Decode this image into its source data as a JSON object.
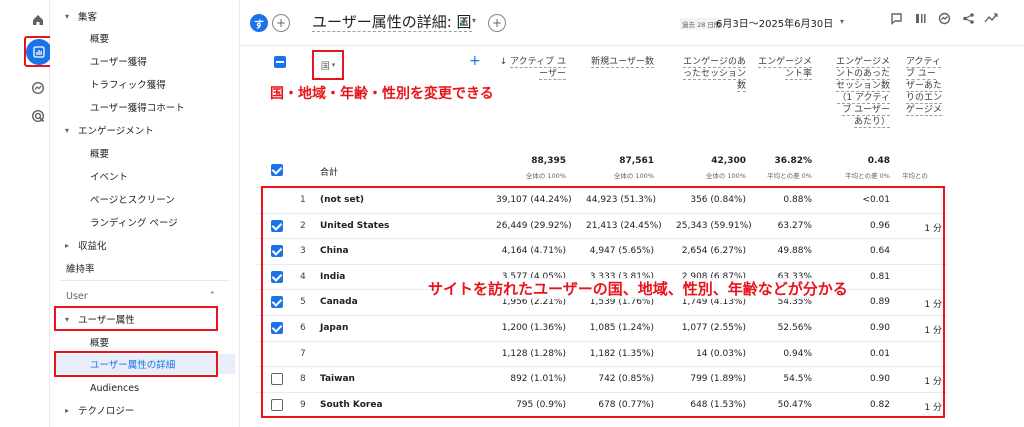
{
  "rail": {
    "items": [
      {
        "icon": "home-icon"
      },
      {
        "icon": "reports-icon",
        "active": true
      },
      {
        "icon": "explore-icon"
      },
      {
        "icon": "advertising-icon"
      }
    ]
  },
  "sidebar": {
    "items": [
      {
        "label": "集客",
        "kind": "group",
        "arrow": "▾"
      },
      {
        "label": "概要",
        "kind": "sub"
      },
      {
        "label": "ユーザー獲得",
        "kind": "sub"
      },
      {
        "label": "トラフィック獲得",
        "kind": "sub"
      },
      {
        "label": "ユーザー獲得コホート",
        "kind": "sub"
      },
      {
        "label": "エンゲージメント",
        "kind": "group",
        "arrow": "▾"
      },
      {
        "label": "概要",
        "kind": "sub"
      },
      {
        "label": "イベント",
        "kind": "sub"
      },
      {
        "label": "ページとスクリーン",
        "kind": "sub"
      },
      {
        "label": "ランディング ページ",
        "kind": "sub"
      },
      {
        "label": "収益化",
        "kind": "group",
        "arrow": "▸"
      },
      {
        "label": "維持率",
        "kind": "plain"
      },
      {
        "label": "User",
        "kind": "section"
      },
      {
        "label": "ユーザー属性",
        "kind": "group",
        "arrow": "▾"
      },
      {
        "label": "概要",
        "kind": "sub"
      },
      {
        "label": "ユーザー属性の詳細",
        "kind": "selected"
      },
      {
        "label": "Audiences",
        "kind": "sub"
      },
      {
        "label": "テクノロジー",
        "kind": "group",
        "arrow": "▸"
      }
    ]
  },
  "header": {
    "avatar_letter": "す",
    "title": "ユーザー属性の詳細: 国",
    "date_badge": "過去 28 日間",
    "date_range": "6月3日～2025年6月30日"
  },
  "table": {
    "dimension_label": "国",
    "columns": [
      "アクティブ ユーザー",
      "新規ユーザー数",
      "エンゲージのあったセッション数",
      "エンゲージメント率",
      "エンゲージメントのあったセッション数（1 アクティブ ユーザーあたり）",
      "アクティブ ユーザーあたりのエンゲージメント"
    ],
    "total_label": "合計",
    "totals": [
      "88,395",
      "87,561",
      "42,300",
      "36.82%",
      "0.48",
      ""
    ],
    "total_subs": [
      "全体の 100%",
      "全体の 100%",
      "全体の 100%",
      "平均との差 0%",
      "平均との差 0%",
      "平均との"
    ],
    "rows": [
      {
        "n": "1",
        "name": "(not set)",
        "checked": null,
        "vals": [
          "39,107 (44.24%)",
          "44,923 (51.3%)",
          "356 (0.84%)",
          "0.88%",
          "<0.01",
          ""
        ]
      },
      {
        "n": "2",
        "name": "United States",
        "checked": true,
        "vals": [
          "26,449 (29.92%)",
          "21,413 (24.45%)",
          "25,343 (59.91%)",
          "63.27%",
          "0.96",
          "1 分"
        ]
      },
      {
        "n": "3",
        "name": "China",
        "checked": true,
        "vals": [
          "4,164 (4.71%)",
          "4,947 (5.65%)",
          "2,654 (6.27%)",
          "49.88%",
          "0.64",
          ""
        ]
      },
      {
        "n": "4",
        "name": "India",
        "checked": true,
        "vals": [
          "3,577 (4.05%)",
          "3,333 (3.81%)",
          "2,908 (6.87%)",
          "63.33%",
          "0.81",
          ""
        ]
      },
      {
        "n": "5",
        "name": "Canada",
        "checked": true,
        "vals": [
          "1,956 (2.21%)",
          "1,539 (1.76%)",
          "1,749 (4.13%)",
          "54.35%",
          "0.89",
          "1 分"
        ]
      },
      {
        "n": "6",
        "name": "Japan",
        "checked": true,
        "vals": [
          "1,200 (1.36%)",
          "1,085 (1.24%)",
          "1,077 (2.55%)",
          "52.56%",
          "0.90",
          "1 分"
        ]
      },
      {
        "n": "7",
        "name": "",
        "checked": null,
        "vals": [
          "1,128 (1.28%)",
          "1,182 (1.35%)",
          "14 (0.03%)",
          "0.94%",
          "0.01",
          ""
        ]
      },
      {
        "n": "8",
        "name": "Taiwan",
        "checked": false,
        "vals": [
          "892 (1.01%)",
          "742 (0.85%)",
          "799 (1.89%)",
          "54.5%",
          "0.90",
          "1 分"
        ]
      },
      {
        "n": "9",
        "name": "South Korea",
        "checked": false,
        "vals": [
          "795 (0.9%)",
          "678 (0.77%)",
          "648 (1.53%)",
          "50.47%",
          "0.82",
          "1 分"
        ]
      }
    ]
  },
  "annotations": {
    "note_dimension": "国・地域・年齢・性別を変更できる",
    "note_table": "サイトを訪れたユーザーの国、地域、性別、年齢などが分かる"
  },
  "colors": {
    "accent": "#1a73e8",
    "highlight": "#e8141b",
    "selected_bg": "#e8eef9"
  }
}
